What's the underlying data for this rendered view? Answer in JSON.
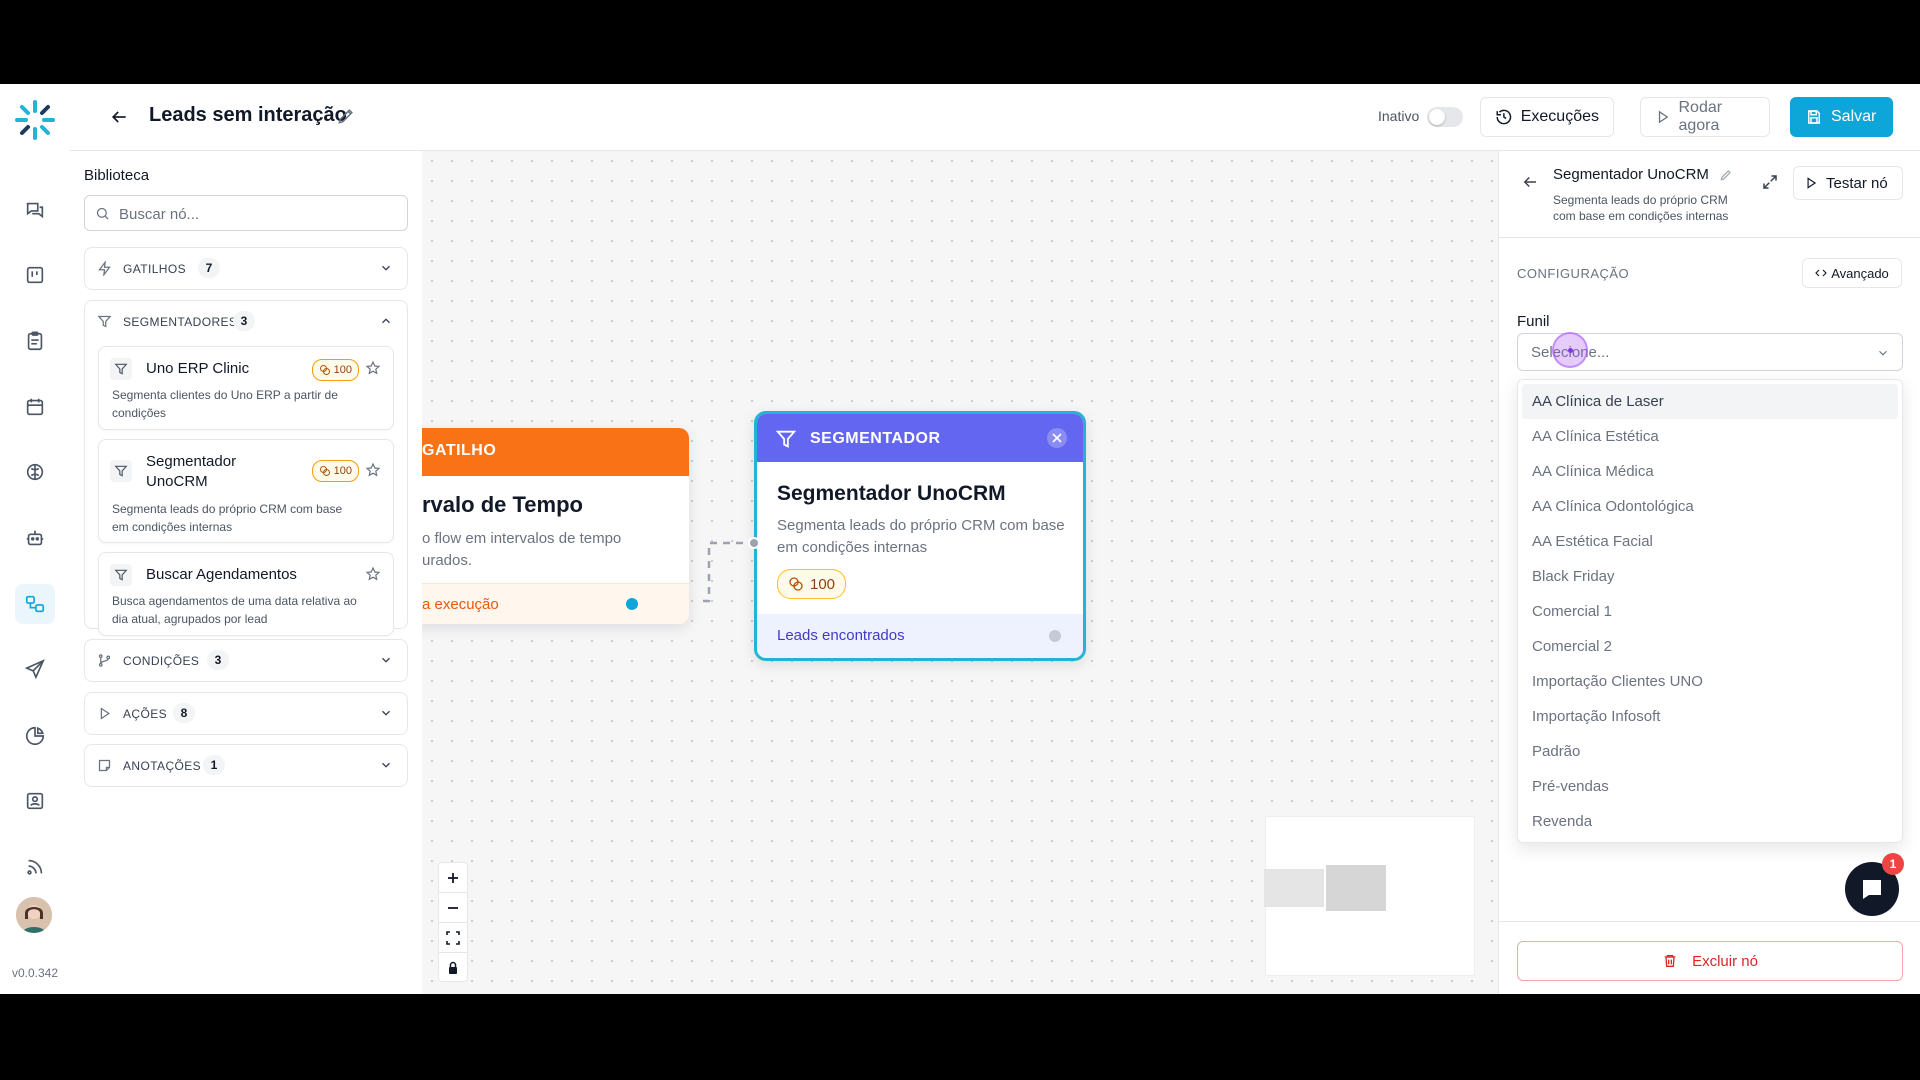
{
  "header": {
    "title": "Leads sem interação",
    "status_label": "Inativo",
    "executions_label": "Execuções",
    "run_now_label": "Rodar agora",
    "save_label": "Salvar"
  },
  "nav": {
    "version": "v0.0.342",
    "items": [
      "chat-icon",
      "kanban-icon",
      "clipboard-icon",
      "calendar-icon",
      "brain-icon",
      "bot-icon",
      "flow-icon",
      "send-icon",
      "pie-chart-icon",
      "contact-icon",
      "rss-icon"
    ],
    "active": "flow-icon"
  },
  "library": {
    "title": "Biblioteca",
    "search_placeholder": "Buscar nó...",
    "sections": {
      "triggers": {
        "label": "GATILHOS",
        "count": "7"
      },
      "segmenters": {
        "label": "SEGMENTADORES",
        "count": "3"
      },
      "conditions": {
        "label": "CONDIÇÕES",
        "count": "3"
      },
      "actions": {
        "label": "AÇÕES",
        "count": "8"
      },
      "notes": {
        "label": "ANOTAÇÕES",
        "count": "1"
      }
    },
    "segmenter_nodes": [
      {
        "name": "Uno ERP Clinic",
        "cost": "100",
        "description": "Segmenta clientes do Uno ERP a partir de condições"
      },
      {
        "name": "Segmentador UnoCRM",
        "cost": "100",
        "description": "Segmenta leads do próprio CRM com base em condições internas"
      },
      {
        "name": "Buscar Agendamentos",
        "cost": "",
        "description": "Busca agendamentos de uma data relativa ao dia atual, agrupados por lead"
      }
    ]
  },
  "canvas": {
    "trigger_node": {
      "header": "GATILHO",
      "title": "rvalo de Tempo",
      "description": "o flow em intervalos de tempo\nurados.",
      "footer": "a execução"
    },
    "segmenter_node": {
      "header": "SEGMENTADOR",
      "title": "Segmentador UnoCRM",
      "description": "Segmenta leads do próprio CRM com base em condições internas",
      "cost": "100",
      "footer": "Leads encontrados"
    }
  },
  "panel": {
    "title": "Segmentador UnoCRM",
    "description": "Segmenta leads do próprio CRM com base em condições internas",
    "test_label": "Testar nó",
    "config_label": "CONFIGURAÇÃO",
    "advanced_label": "Avançado",
    "field_label": "Funil",
    "select_placeholder": "Selecione...",
    "options": [
      "AA Clínica de Laser",
      "AA Clínica Estética",
      "AA Clínica Médica",
      "AA Clínica Odontológica",
      "AA Estética Facial",
      "Black Friday",
      "Comercial 1",
      "Comercial 2",
      "Importação Clientes UNO",
      "Importação Infosoft",
      "Padrão",
      "Pré-vendas",
      "Revenda"
    ],
    "highlighted_option": "AA Clínica de Laser",
    "delete_label": "Excluir nó",
    "chat_badge": "1"
  },
  "colors": {
    "accent": "#0ea5d8",
    "trigger": "#f97316",
    "segmenter": "#6366f1",
    "danger": "#dc2626"
  }
}
